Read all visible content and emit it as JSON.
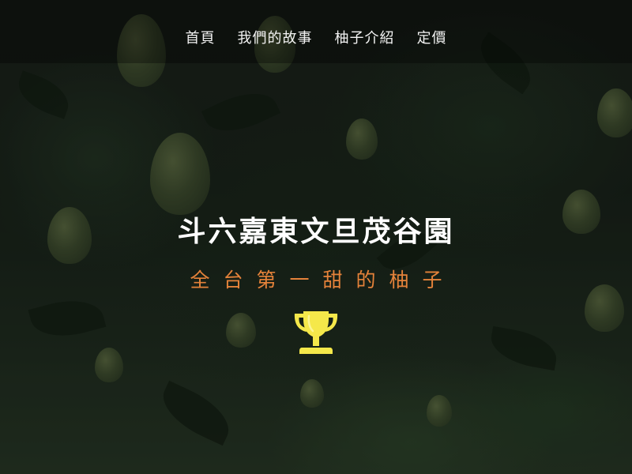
{
  "nav": {
    "items": [
      {
        "label": "首頁"
      },
      {
        "label": "我們的故事"
      },
      {
        "label": "柚子介紹"
      },
      {
        "label": "定價"
      }
    ]
  },
  "hero": {
    "title": "斗六嘉東文旦茂谷園",
    "subtitle": "全台第一甜的柚子",
    "icon": "trophy-icon"
  },
  "colors": {
    "subtitle": "#e4823a",
    "trophy": "#f5e84a",
    "title": "#ffffff"
  }
}
